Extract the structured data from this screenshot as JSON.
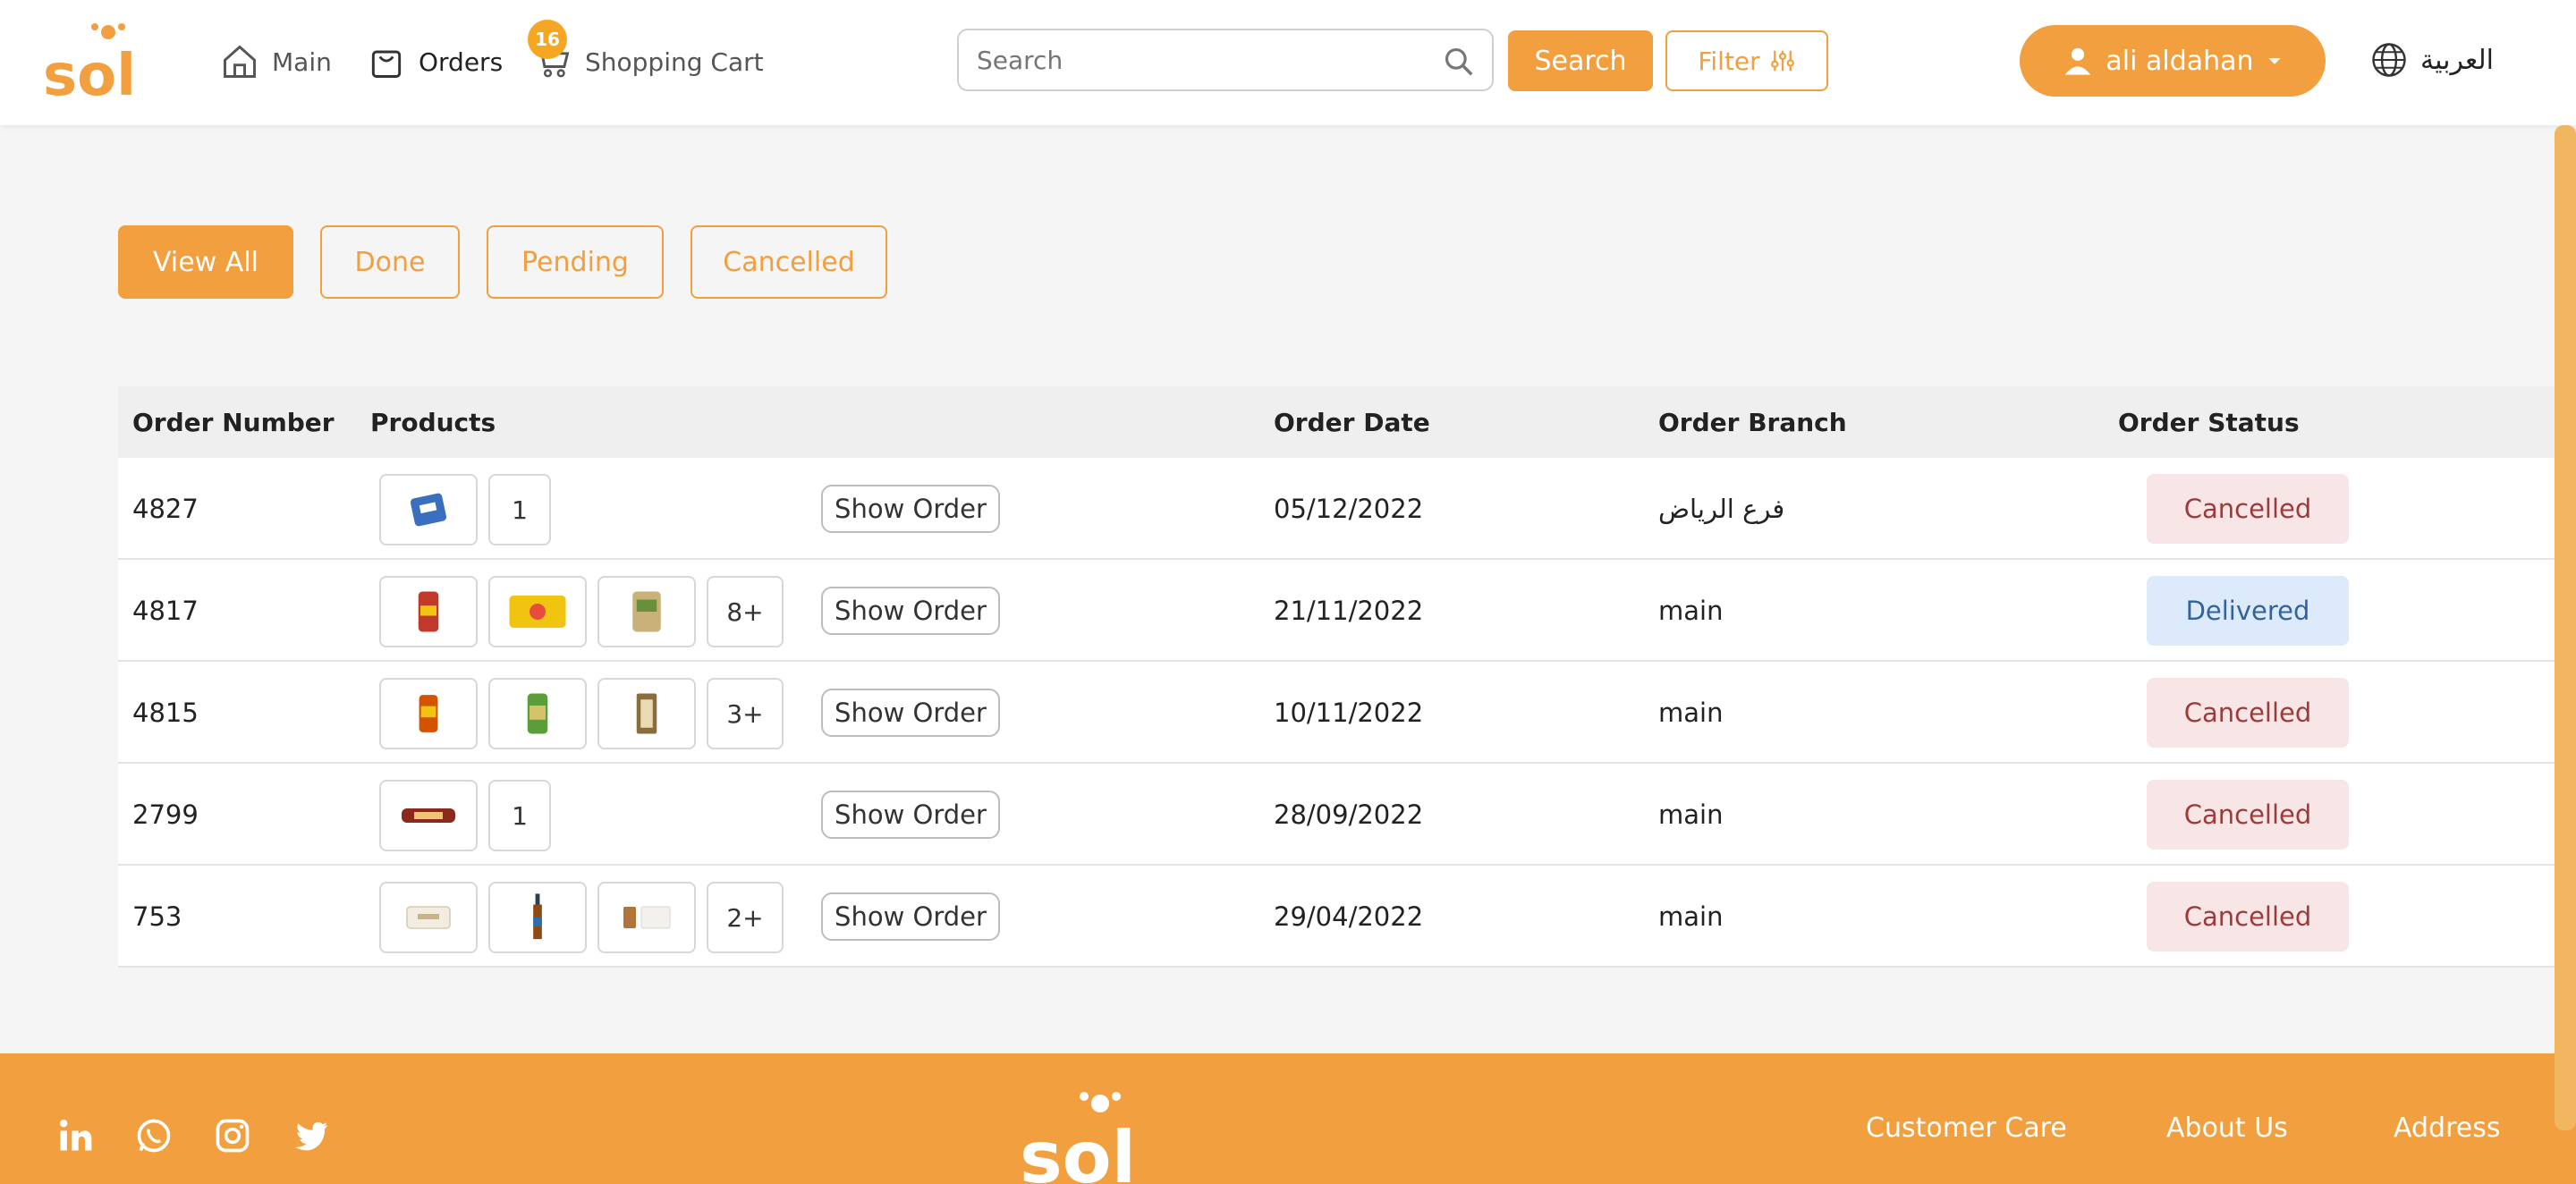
{
  "header": {
    "brand": "Sol",
    "nav": [
      {
        "label": "Main",
        "icon": "home-icon"
      },
      {
        "label": "Orders",
        "icon": "bag-icon"
      },
      {
        "label": "Shopping Cart",
        "icon": "cart-icon"
      }
    ],
    "cart_count": "16",
    "search": {
      "placeholder": "Search",
      "button": "Search"
    },
    "filter_label": "Filter",
    "user_name": "ali aldahan",
    "language": "العربية"
  },
  "tabs": [
    "View All",
    "Done",
    "Pending",
    "Cancelled"
  ],
  "table": {
    "headers": [
      "Order Number",
      "Products",
      "Order Date",
      "Order Branch",
      "Order Status"
    ],
    "show_label": "Show Order",
    "rows": [
      {
        "number": "4827",
        "products": 1,
        "more": "1",
        "date": "05/12/2022",
        "branch": "فرع الرياض",
        "status": "Cancelled"
      },
      {
        "number": "4817",
        "products": 3,
        "more": "8+",
        "date": "21/11/2022",
        "branch": "main",
        "status": "Delivered"
      },
      {
        "number": "4815",
        "products": 3,
        "more": "3+",
        "date": "10/11/2022",
        "branch": "main",
        "status": "Cancelled"
      },
      {
        "number": "2799",
        "products": 1,
        "more": "1",
        "date": "28/09/2022",
        "branch": "main",
        "status": "Cancelled"
      },
      {
        "number": "753",
        "products": 3,
        "more": "2+",
        "date": "29/04/2022",
        "branch": "main",
        "status": "Cancelled"
      }
    ]
  },
  "footer": {
    "links": [
      "Customer Care",
      "About Us",
      "Address"
    ],
    "social": [
      "linkedin-icon",
      "whatsapp-icon",
      "instagram-icon",
      "twitter-icon"
    ]
  },
  "colors": {
    "accent": "#f19f3f",
    "cancelled_bg": "#f8e6e6",
    "delivered_bg": "#ddeafb"
  }
}
